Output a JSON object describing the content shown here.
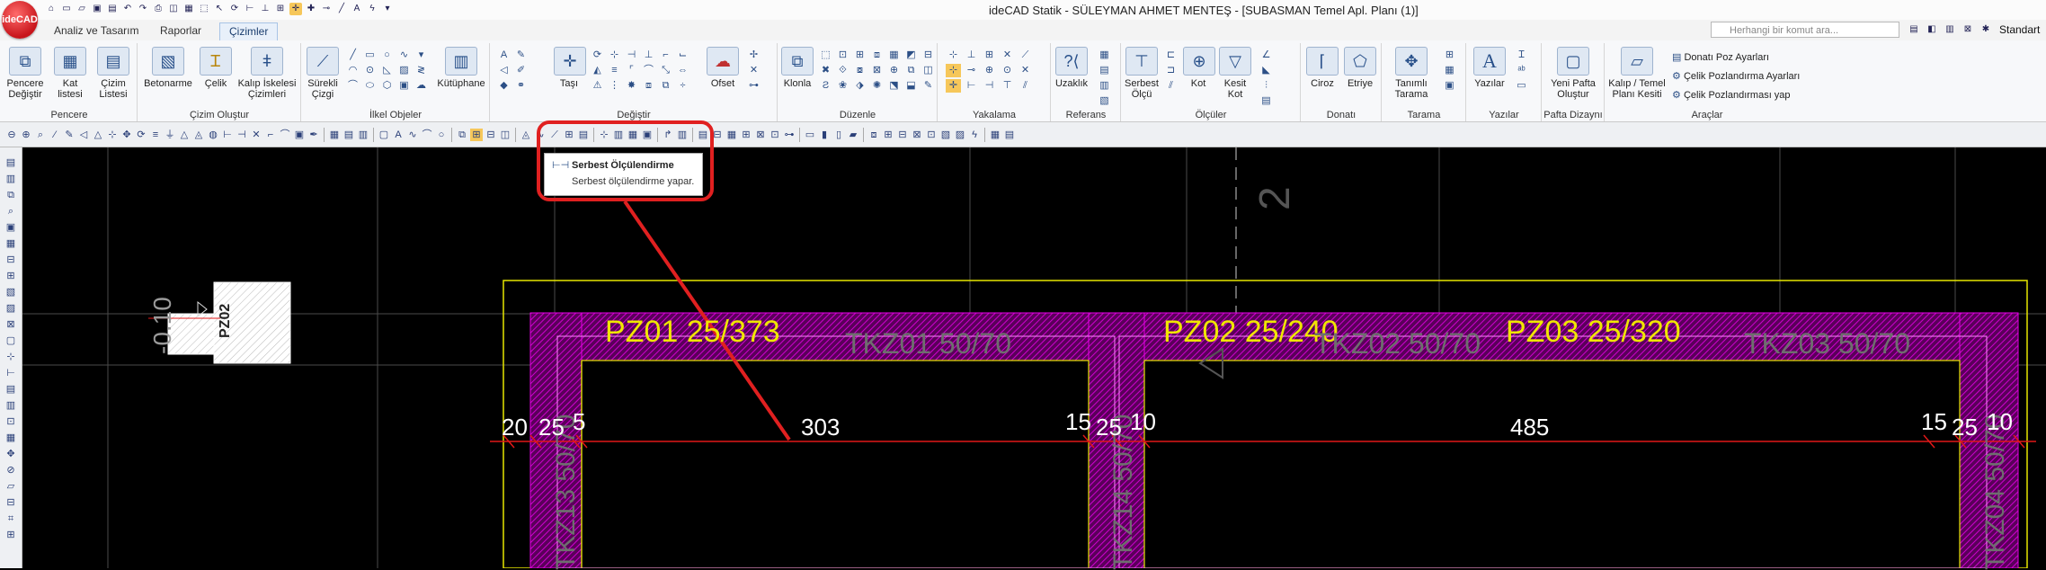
{
  "app": {
    "logo_text": "ideCAD",
    "window_title": "ideCAD Statik - SÜLEYMAN AHMET MENTEŞ  - [SUBASMAN Temel Apl. Planı (1)]",
    "search_placeholder": "Herhangi bir komut ara...",
    "style_label": "Standart"
  },
  "tabs": [
    {
      "label": "Analiz ve Tasarım"
    },
    {
      "label": "Raporlar"
    },
    {
      "label": "Çizimler"
    }
  ],
  "ribbon": {
    "groups": {
      "pencere": "Pencere",
      "cizim_olustur": "Çizim Oluştur",
      "ilkel": "İlkel Objeler",
      "degistir": "Değiştir",
      "duzenle": "Düzenle",
      "yakalama": "Yakalama",
      "referans": "Referans",
      "olculer": "Ölçüler",
      "donati": "Donatı",
      "tarama": "Tarama",
      "yazilar": "Yazılar",
      "pafta": "Pafta Dizaynı",
      "araclar": "Araçlar"
    },
    "buttons": {
      "pencere_degistir": "Pencere Değiştir",
      "kat_listesi": "Kat listesi",
      "cizim_listesi": "Çizim Listesi",
      "betonarme": "Betonarme",
      "celik": "Çelik",
      "kalip_iskelesi": "Kalıp İskelesi Çizimleri",
      "surekli_cizgi": "Sürekli Çizgi",
      "kutuphane": "Kütüphane",
      "tasi": "Taşı",
      "ofset": "Ofset",
      "klonla": "Klonla",
      "uzaklik": "Uzaklık",
      "serbest_olcu": "Serbest Ölçü",
      "kot": "Kot",
      "kesit_kot": "Kesit Kot",
      "ciroz": "Ciroz",
      "etriye": "Etriye",
      "tanimli_tarama": "Tanımlı Tarama",
      "yazilar": "Yazılar",
      "yeni_pafta": "Yeni Pafta Oluştur",
      "kalip_temel": "Kalıp / Temel Planı Kesiti",
      "donati_poz": "Donatı Poz Ayarları",
      "celik_poz_ayar": "Çelik Pozlandırma Ayarları",
      "celik_poz_yap": "Çelik Pozlandırması yap"
    }
  },
  "tooltip": {
    "title": "Serbest Ölçülendirme",
    "description": "Serbest ölçülendirme yapar."
  },
  "drawing": {
    "elevation": "-0.10",
    "column_label": "PZ02",
    "beams_pz": [
      {
        "label": "PZ01 25/373"
      },
      {
        "label": "PZ02 25/240"
      },
      {
        "label": "PZ03 25/320"
      }
    ],
    "beams_tkz": [
      {
        "label": "TKZ01 50/70"
      },
      {
        "label": "TKZ02 50/70"
      },
      {
        "label": "TKZ03 50/70"
      }
    ],
    "dims": [
      {
        "text": "20"
      },
      {
        "text": "25"
      },
      {
        "text": "5"
      },
      {
        "text": "303"
      },
      {
        "text": "15"
      },
      {
        "text": "25"
      },
      {
        "text": "10"
      },
      {
        "text": "485"
      },
      {
        "text": "15"
      },
      {
        "text": "25"
      },
      {
        "text": "10"
      }
    ],
    "vertical_tkz": [
      {
        "label": "TKZ13 50/70"
      },
      {
        "label": "TKZ14 50/70"
      },
      {
        "label": "TKZ04 50/70"
      }
    ],
    "top_fragment": "2"
  },
  "colors": {
    "highlight": "#e02020",
    "pz_text": "#f0e600",
    "tkz_text": "#6e6e6e",
    "dim_line": "#e01818",
    "magenta": "#c000c0"
  }
}
